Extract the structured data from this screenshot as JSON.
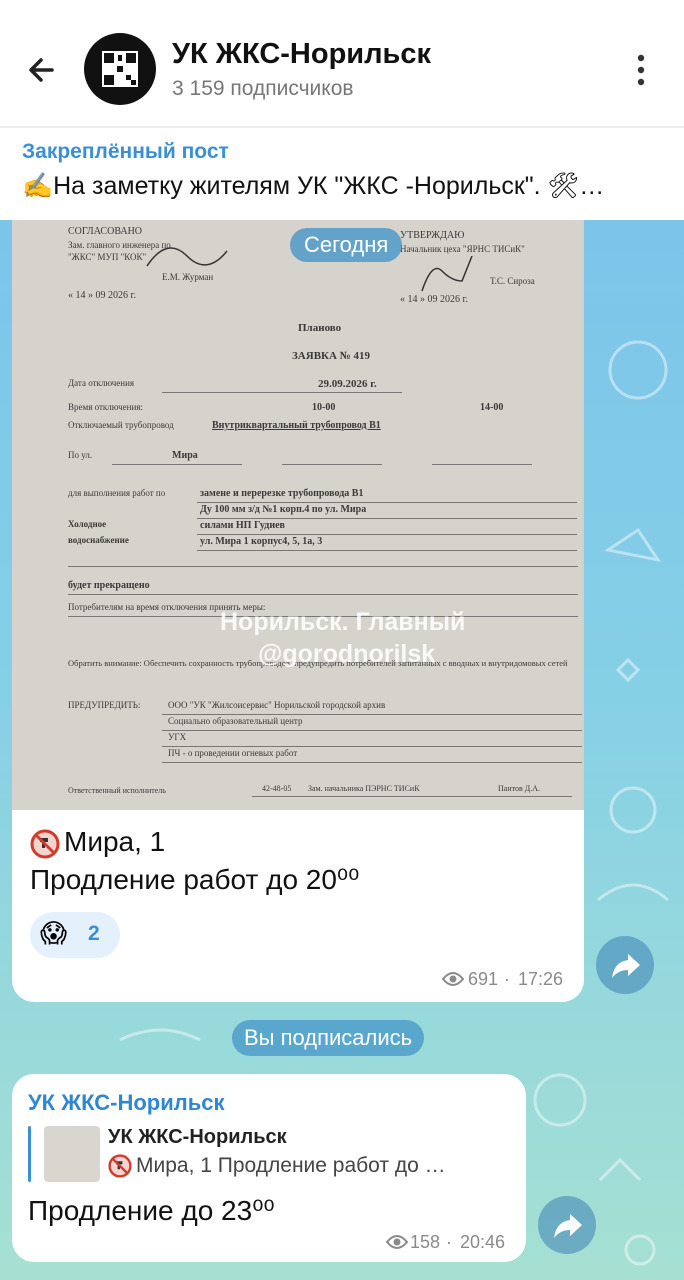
{
  "header": {
    "channel_name": "УК ЖКС-Норильск",
    "subscribers": "3 159 подписчиков"
  },
  "pinned": {
    "label": "Закреплённый пост",
    "text": "✍️На заметку жителям УК \"ЖКС -Норильск\". 🛠…"
  },
  "date_separator": "Сегодня",
  "post1": {
    "document": {
      "left_header": [
        "СОГЛАСОВАНО",
        "Зам. главного инженера по",
        "\"ЖКС\" МУП \"КОК\"",
        "Е.М. Журман",
        "« 14 » 09 2026 г."
      ],
      "right_header": [
        "УТВЕРЖДАЮ",
        "Начальник цеха \"ЯРНС ТИСиК\"",
        "Т.С. Сироза",
        "« 14 » 09 2026 г."
      ],
      "title1": "Планово",
      "title2": "ЗАЯВКА № 419",
      "date_label": "Дата отключения",
      "date_value": "29.09.2026 г.",
      "time_label": "Время отключения:",
      "time_from": "10-00",
      "time_to": "14-00",
      "pipe_label": "Отключаемый трубопровод",
      "pipe_value": "Внутриквартальный трубопровод В1",
      "street_label": "По ул.",
      "street_value": "Мира",
      "work_label": "для выполнения работ по",
      "work_value1": "замене и перерезке трубопровода В1",
      "work_value2": "Ду 100 мм з/д №1 корп.4 по ул. Мира",
      "work_value3": "силами НП Гудиев",
      "cold_water": "Холодное водоснабжение",
      "address": "ул. Мира 1 корпус4, 5, 1а, 3",
      "will_stop": "будет прекращено",
      "consumers": "Потребителям на время отключения принять меры:",
      "attention": "Обратить внимание: Обеспечить сохранность трубопроводов, предупредить потребителей запитанных с вводных и внутридомовых сетей",
      "warn_label": "ПРЕДУПРЕДИТЬ:",
      "warn_lines": [
        "ООО \"УК \"Жилсоисервис\" Норильской городской архив",
        "Социально образовательный центр",
        "УГХ",
        "ПЧ - о проведении огневых работ"
      ],
      "responsible": "Ответственный исполнитель",
      "phone": "42-48-05",
      "deputy": "Зам. начальника ПЭРНС ТИСиК",
      "signer": "Пантов Д.А."
    },
    "watermark_line1": "Норильск. Главный",
    "watermark_line2": "@gorodnorilsk",
    "caption_line1": "Мира, 1",
    "caption_line2": "Продление работ до 20⁰⁰",
    "reaction_emoji": "😱",
    "reaction_count": "2",
    "views": "691",
    "time": "17:26"
  },
  "subscribed_notice": "Вы подписались",
  "post2": {
    "author": "УК ЖКС-Норильск",
    "reply_name": "УК ЖКС-Норильск",
    "reply_text": "Мира, 1 Продление работ до …",
    "text": "Продление до 23⁰⁰",
    "views": "158",
    "time": "20:46"
  }
}
